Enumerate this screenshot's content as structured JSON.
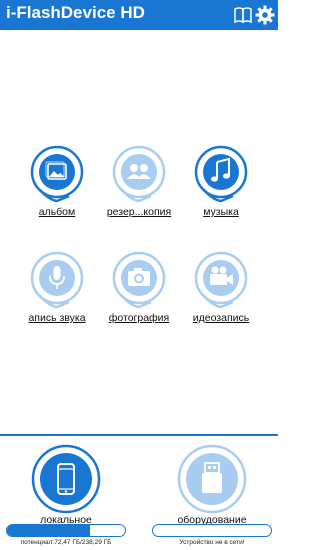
{
  "header": {
    "title": "i-FlashDevice HD",
    "icons": [
      "book-icon",
      "gear-icon"
    ]
  },
  "colors": {
    "primary": "#1976d2",
    "light_ring": "#a9cdf0"
  },
  "tiles": [
    {
      "label": "альбом",
      "icon": "photo-album-icon",
      "active": true
    },
    {
      "label": "резер...копия",
      "icon": "backup-people-icon",
      "active": false
    },
    {
      "label": "музыка",
      "icon": "music-note-icon",
      "active": true
    },
    {
      "label": "апись звука",
      "icon": "microphone-icon",
      "active": false
    },
    {
      "label": "фотография",
      "icon": "camera-icon",
      "active": false
    },
    {
      "label": "идеозапись",
      "icon": "video-camera-icon",
      "active": false
    }
  ],
  "bottom": {
    "local": {
      "label": "локальное",
      "caption": "потенциал:72,47 ГБ/238,29 ГБ",
      "used_fraction": 0.7
    },
    "hardware": {
      "label": "оборудование",
      "caption": "Устройство не в сети!",
      "used_fraction": 0
    }
  }
}
